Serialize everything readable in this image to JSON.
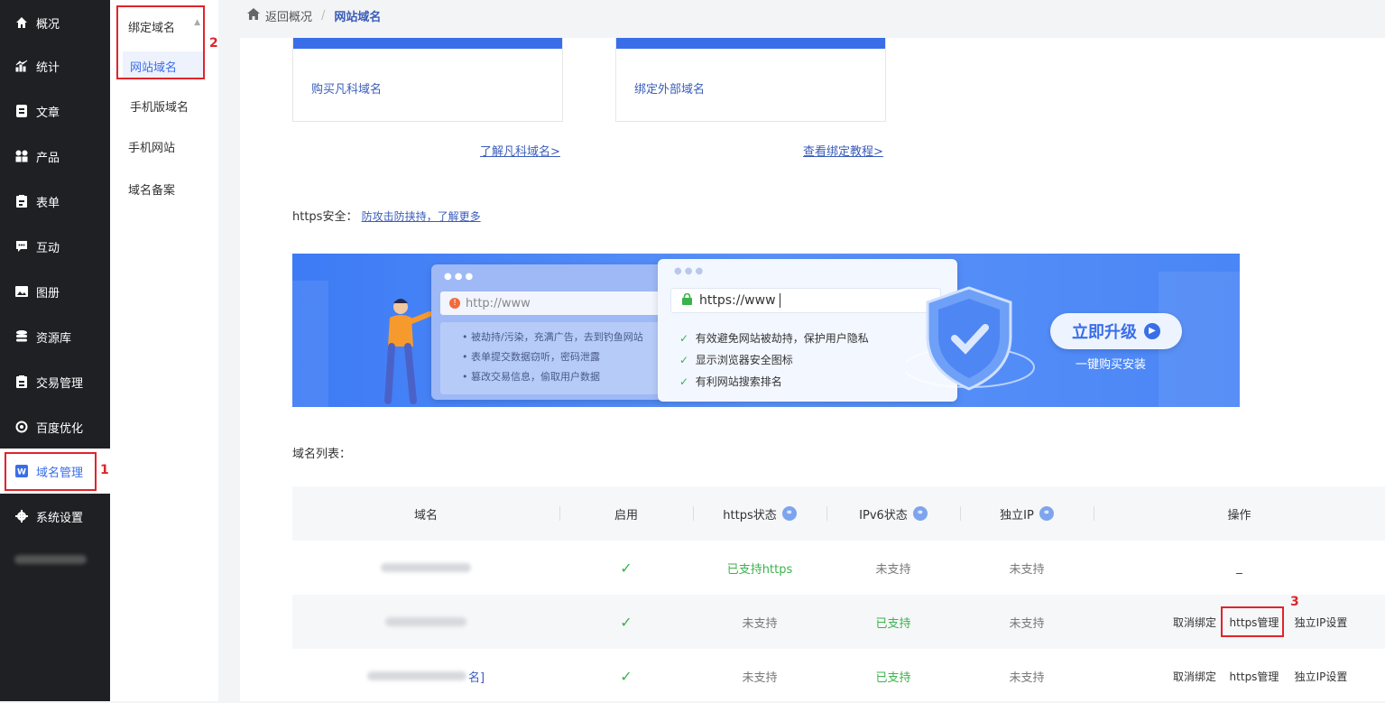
{
  "sidebar": {
    "items": [
      {
        "label": "概况",
        "icon": "home-icon"
      },
      {
        "label": "统计",
        "icon": "chart-icon"
      },
      {
        "label": "文章",
        "icon": "article-icon"
      },
      {
        "label": "产品",
        "icon": "grid-icon"
      },
      {
        "label": "表单",
        "icon": "form-icon"
      },
      {
        "label": "互动",
        "icon": "chat-icon"
      },
      {
        "label": "图册",
        "icon": "album-icon"
      },
      {
        "label": "资源库",
        "icon": "database-icon"
      },
      {
        "label": "交易管理",
        "icon": "trade-icon"
      },
      {
        "label": "百度优化",
        "icon": "seo-icon"
      },
      {
        "label": "域名管理",
        "icon": "domain-icon"
      },
      {
        "label": "系统设置",
        "icon": "gear-icon"
      }
    ],
    "active": "域名管理"
  },
  "subnav": {
    "group": "绑定域名",
    "items": [
      "网站域名",
      "手机版域名",
      "手机网站",
      "域名备案"
    ]
  },
  "annotations": [
    "1",
    "2",
    "3"
  ],
  "breadcrumb": {
    "back": "返回概况",
    "sep": "/",
    "current": "网站域名"
  },
  "cards": [
    {
      "title": "购买凡科域名",
      "link": "了解凡科域名>"
    },
    {
      "title": "绑定外部域名",
      "link": "查看绑定教程>"
    }
  ],
  "https": {
    "label": "https安全：",
    "link": "防攻击防挟持，了解更多"
  },
  "banner": {
    "left_url": "http://www",
    "left_points": [
      "被劫持/污染，充满广告，去到钓鱼网站",
      "表单提交数据窃听，密码泄露",
      "篡改交易信息，偷取用户数据"
    ],
    "right_url": "https://www",
    "right_points": [
      "有效避免网站被劫持，保护用户隐私",
      "显示浏览器安全图标",
      "有利网站搜索排名"
    ],
    "cta": "立即升级",
    "cta_sub": "一键购买安装"
  },
  "list_label": "域名列表：",
  "table": {
    "headers": [
      "域名",
      "启用",
      "https状态",
      "IPv6状态",
      "独立IP",
      "操作"
    ],
    "rows": [
      {
        "domain_tail": "",
        "enabled": "✓",
        "https": "已支持https",
        "ipv6": "未支持",
        "ip": "未支持",
        "ops": [
          "_"
        ]
      },
      {
        "domain_tail": "",
        "enabled": "✓",
        "https": "未支持",
        "ipv6": "已支持",
        "ip": "未支持",
        "ops": [
          "取消绑定",
          "https管理",
          "独立IP设置"
        ]
      },
      {
        "domain_tail": "名]",
        "enabled": "✓",
        "https": "未支持",
        "ipv6": "已支持",
        "ip": "未支持",
        "ops": [
          "取消绑定",
          "https管理",
          "独立IP设置"
        ]
      }
    ]
  }
}
